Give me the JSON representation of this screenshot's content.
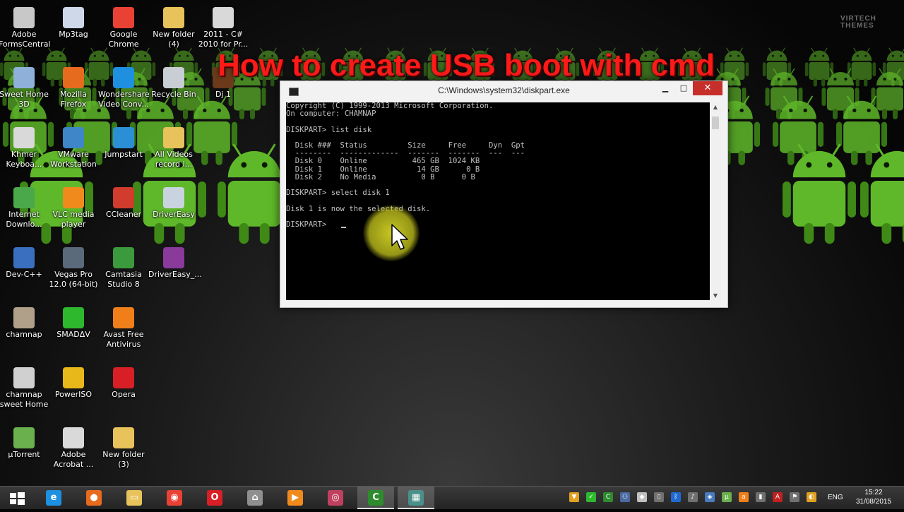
{
  "overlay": {
    "title": "How to create USB boot with cmd",
    "watermark_line1": "VIRTECH",
    "watermark_line2": "THEMES"
  },
  "desktop": {
    "icons": [
      {
        "name": "Adobe FormsCentral",
        "label": "Adobe\nFormsCentral",
        "icon": "pdf-form-icon",
        "color": "#c8c8c8"
      },
      {
        "name": "Mp3tag",
        "label": "Mp3tag",
        "icon": "tag-icon",
        "color": "#cfd8e8"
      },
      {
        "name": "Google Chrome",
        "label": "Google\nChrome",
        "icon": "chrome-icon",
        "color": "#e94235"
      },
      {
        "name": "New folder (4)",
        "label": "New folder\n(4)",
        "icon": "folder-icon",
        "color": "#e8c25a"
      },
      {
        "name": "2011 - C# 2010 for Pr...",
        "label": "2011 - C#\n2010 for Pr...",
        "icon": "pdf-icon",
        "color": "#d9d9d9"
      },
      {
        "name": "Sweet Home 3D",
        "label": "Sweet Home\n3D",
        "icon": "house-icon",
        "color": "#8fb0d8"
      },
      {
        "name": "Mozilla Firefox",
        "label": "Mozilla\nFirefox",
        "icon": "firefox-icon",
        "color": "#e66b1e"
      },
      {
        "name": "Wondershare Video Conv...",
        "label": "Wondershare\nVideo Conv...",
        "icon": "video-convert-icon",
        "color": "#1f8fe0"
      },
      {
        "name": "Recycle Bin",
        "label": "Recycle Bin",
        "icon": "recycle-bin-icon",
        "color": "#c9ced4"
      },
      {
        "name": "Dj 1",
        "label": "Dj 1",
        "icon": "dj-image-icon",
        "color": "#6a3a1a"
      },
      {
        "name": "Khmer Keyboa...",
        "label": "Khmer\nKeyboa...",
        "icon": "pdf-icon",
        "color": "#d9d9d9"
      },
      {
        "name": "VMware Workstation",
        "label": "VMware\nWorkstation",
        "icon": "vmware-icon",
        "color": "#3f86c8"
      },
      {
        "name": "Jumpstart",
        "label": "Jumpstart",
        "icon": "jumpstart-icon",
        "color": "#2b8fd6"
      },
      {
        "name": "All Videos record i...",
        "label": "All Videos\nrecord i...",
        "icon": "folder-icon",
        "color": "#e8c25a"
      },
      {
        "name": "Internet Downlo...",
        "label": "Internet\nDownlo...",
        "icon": "download-manager-icon",
        "color": "#4aa84a"
      },
      {
        "name": "VLC media player",
        "label": "VLC media\nplayer",
        "icon": "vlc-cone-icon",
        "color": "#f08a1c"
      },
      {
        "name": "CCleaner",
        "label": "CCleaner",
        "icon": "ccleaner-icon",
        "color": "#d23c2c"
      },
      {
        "name": "DriverEasy",
        "label": "DriverEasy",
        "icon": "drivereasy-icon",
        "color": "#c9d3df"
      },
      {
        "name": "Dev-C++",
        "label": "Dev-C++",
        "icon": "dev-cpp-icon",
        "color": "#3a6fc0"
      },
      {
        "name": "Vegas Pro 12.0 (64-bit)",
        "label": "Vegas Pro\n12.0 (64-bit)",
        "icon": "vegas-play-icon",
        "color": "#5b6a7a"
      },
      {
        "name": "Camtasia Studio 8",
        "label": "Camtasia\nStudio 8",
        "icon": "camtasia-icon",
        "color": "#3b9a3b"
      },
      {
        "name": "DriverEasy_...",
        "label": "DriverEasy_...",
        "icon": "winrar-archive-icon",
        "color": "#8a3a9a"
      },
      {
        "name": "chamnap",
        "label": "chamnap",
        "icon": "user-image-icon",
        "color": "#b0a08a"
      },
      {
        "name": "SMADAV",
        "label": "SMADΔV",
        "icon": "smadav-icon",
        "color": "#2eb82e"
      },
      {
        "name": "Avast Free Antivirus",
        "label": "Avast Free\nAntivirus",
        "icon": "avast-icon",
        "color": "#f07f1a"
      },
      {
        "name": "chamnap sweet Home",
        "label": "chamnap\nsweet Home",
        "icon": "house-shortcut-icon",
        "color": "#d0d0d0"
      },
      {
        "name": "PowerISO",
        "label": "PowerISO",
        "icon": "poweriso-icon",
        "color": "#e8b81a"
      },
      {
        "name": "Opera",
        "label": "Opera",
        "icon": "opera-icon",
        "color": "#d81f26"
      },
      {
        "name": "µTorrent",
        "label": "µTorrent",
        "icon": "utorrent-icon",
        "color": "#6ab04c"
      },
      {
        "name": "Adobe Acrobat ...",
        "label": "Adobe\nAcrobat ...",
        "icon": "acrobat-icon",
        "color": "#d9d9d9"
      },
      {
        "name": "New folder (3)",
        "label": "New folder\n(3)",
        "icon": "folder-icon",
        "color": "#e8c25a"
      }
    ]
  },
  "cmd": {
    "title": "C:\\Windows\\system32\\diskpart.exe",
    "minimize_glyph": "▁",
    "maximize_glyph": "□",
    "close_glyph": "✕",
    "scroll_up_glyph": "▲",
    "scroll_down_glyph": "▼",
    "console_text": "Copyright (C) 1999-2013 Microsoft Corporation.\nOn computer: CHAMNAP\n\nDISKPART> list disk\n\n  Disk ###  Status         Size     Free     Dyn  Gpt\n  --------  -------------  -------  -------  ---  ---\n  Disk 0    Online          465 GB  1024 KB\n  Disk 1    Online           14 GB      0 B\n  Disk 2    No Media          0 B      0 B\n\nDISKPART> select disk 1\n\nDisk 1 is now the selected disk.\n\nDISKPART> "
  },
  "taskbar": {
    "start_label": "Start",
    "apps": [
      {
        "name": "Internet Explorer",
        "icon": "internet-explorer-icon",
        "glyph": "e",
        "color": "#1e90e0"
      },
      {
        "name": "Firefox",
        "icon": "firefox-icon",
        "glyph": "●",
        "color": "#e66b1e"
      },
      {
        "name": "File Explorer",
        "icon": "file-explorer-icon",
        "glyph": "▭",
        "color": "#e8c25a"
      },
      {
        "name": "Google Chrome",
        "icon": "chrome-icon",
        "glyph": "◉",
        "color": "#e94235"
      },
      {
        "name": "Opera",
        "icon": "opera-icon",
        "glyph": "O",
        "color": "#d81f26"
      },
      {
        "name": "Sweet Home 3D",
        "icon": "house-icon",
        "glyph": "⌂",
        "color": "#8f8f8f"
      },
      {
        "name": "VLC",
        "icon": "media-player-icon",
        "glyph": "▶",
        "color": "#f08a1c"
      },
      {
        "name": "Magnifier",
        "icon": "user-tool-icon",
        "glyph": "◎",
        "color": "#c04060"
      },
      {
        "name": "Camtasia Recorder",
        "icon": "camtasia-icon",
        "glyph": "C",
        "color": "#2e8b2e"
      },
      {
        "name": "Command Prompt",
        "icon": "cmd-window-icon",
        "glyph": "▦",
        "color": "#4a8f8a"
      }
    ],
    "tray": [
      {
        "icon": "tray-arrow-icon",
        "glyph": "▼",
        "color": "#e0a020"
      },
      {
        "icon": "tray-smadav-icon",
        "glyph": "✓",
        "color": "#2eb82e"
      },
      {
        "icon": "tray-camtasia-icon",
        "glyph": "C",
        "color": "#2e8b2e"
      },
      {
        "icon": "tray-network-icon",
        "glyph": "⚇",
        "color": "#4a6aa0"
      },
      {
        "icon": "tray-poweriso-icon",
        "glyph": "◆",
        "color": "#c0c0c0"
      },
      {
        "icon": "tray-battery-icon",
        "glyph": "▯",
        "color": "#707070"
      },
      {
        "icon": "tray-bluetooth-icon",
        "glyph": "ᛒ",
        "color": "#1e6ad0"
      },
      {
        "icon": "tray-volume-icon",
        "glyph": "♪",
        "color": "#707070"
      },
      {
        "icon": "tray-shield-icon",
        "glyph": "◈",
        "color": "#4a7ac0"
      },
      {
        "icon": "tray-utorrent-icon",
        "glyph": "µ",
        "color": "#6ab04c"
      },
      {
        "icon": "tray-avast-icon",
        "glyph": "a",
        "color": "#f07f1a"
      },
      {
        "icon": "tray-network-signal-icon",
        "glyph": "▮",
        "color": "#707070"
      },
      {
        "icon": "tray-acrobat-icon",
        "glyph": "A",
        "color": "#c02020"
      },
      {
        "icon": "tray-flag-icon",
        "glyph": "⚑",
        "color": "#707070"
      },
      {
        "icon": "tray-update-icon",
        "glyph": "◐",
        "color": "#e0a020"
      }
    ],
    "language": "ENG",
    "time": "15:22",
    "date": "31/08/2015"
  }
}
